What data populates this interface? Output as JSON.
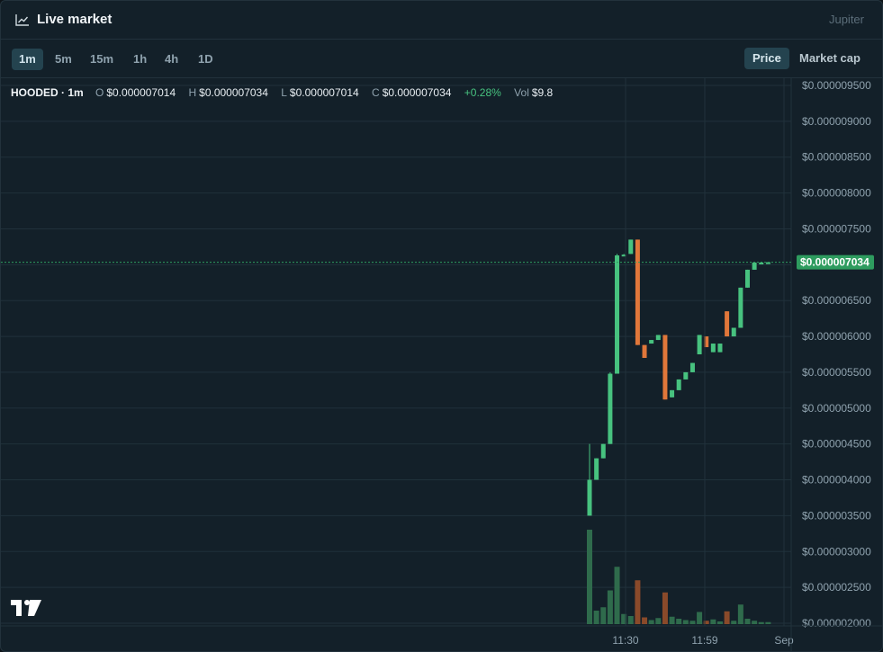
{
  "header": {
    "title": "Live market",
    "provider": "Jupiter",
    "icon": "chart-line-icon"
  },
  "toolbar": {
    "timeframes": [
      "1m",
      "5m",
      "15m",
      "1h",
      "4h",
      "1D"
    ],
    "active_timeframe": "1m",
    "price_label": "Price",
    "marketcap_label": "Market cap",
    "active_toggle": "Price"
  },
  "legend": {
    "symbol": "HOODED · 1m",
    "o_label": "O",
    "o_value": "$0.000007014",
    "h_label": "H",
    "h_value": "$0.000007034",
    "l_label": "L",
    "l_value": "$0.000007014",
    "c_label": "C",
    "c_value": "$0.000007034",
    "change": "+0.28%",
    "vol_label": "Vol",
    "vol_value": "$9.8"
  },
  "colors": {
    "up": "#47c27f",
    "down": "#e0773a",
    "vol_up": "#2f6b4c",
    "vol_down": "#8a4a2a",
    "grid": "#20313b",
    "last_price_bg": "#2e9c5f"
  },
  "chart_data": {
    "type": "candlestick",
    "x_ticks": [
      "11:30",
      "11:59",
      "Sep"
    ],
    "y_ticks": [
      "$0.000009500",
      "$0.000009000",
      "$0.000008500",
      "$0.000008000",
      "$0.000007500",
      "$0.000007000",
      "$0.000006500",
      "$0.000006000",
      "$0.000005500",
      "$0.000005000",
      "$0.000004500",
      "$0.000004000",
      "$0.000003500",
      "$0.000003000",
      "$0.000002500",
      "$0.000002000"
    ],
    "ylim": [
      2e-06,
      9.5e-06
    ],
    "last_price": 7.034e-06,
    "last_price_label": "$0.000007034",
    "candles": [
      {
        "o": 3.5e-06,
        "h": 4.5e-06,
        "l": 3.5e-06,
        "c": 4e-06,
        "v": 14,
        "dir": "up"
      },
      {
        "o": 4e-06,
        "h": 4.3e-06,
        "l": 4e-06,
        "c": 4.3e-06,
        "v": 2,
        "dir": "up"
      },
      {
        "o": 4.3e-06,
        "h": 4.5e-06,
        "l": 4.3e-06,
        "c": 4.5e-06,
        "v": 2.5,
        "dir": "up"
      },
      {
        "o": 4.5e-06,
        "h": 5.5e-06,
        "l": 4.5e-06,
        "c": 5.48e-06,
        "v": 5,
        "dir": "up"
      },
      {
        "o": 5.48e-06,
        "h": 7.15e-06,
        "l": 5.48e-06,
        "c": 7.13e-06,
        "v": 8.5,
        "dir": "up"
      },
      {
        "o": 7.13e-06,
        "h": 7.15e-06,
        "l": 7.13e-06,
        "c": 7.14e-06,
        "v": 1.5,
        "dir": "up"
      },
      {
        "o": 7.15e-06,
        "h": 7.35e-06,
        "l": 7.15e-06,
        "c": 7.35e-06,
        "v": 1.2,
        "dir": "up"
      },
      {
        "o": 7.35e-06,
        "h": 7.35e-06,
        "l": 5.88e-06,
        "c": 5.88e-06,
        "v": 6.5,
        "dir": "down"
      },
      {
        "o": 5.88e-06,
        "h": 5.88e-06,
        "l": 5.7e-06,
        "c": 5.7e-06,
        "v": 1,
        "dir": "down"
      },
      {
        "o": 5.9e-06,
        "h": 5.95e-06,
        "l": 5.9e-06,
        "c": 5.95e-06,
        "v": 0.6,
        "dir": "up"
      },
      {
        "o": 5.95e-06,
        "h": 6.02e-06,
        "l": 5.95e-06,
        "c": 6.02e-06,
        "v": 0.9,
        "dir": "up"
      },
      {
        "o": 6.02e-06,
        "h": 6.02e-06,
        "l": 5.12e-06,
        "c": 5.12e-06,
        "v": 4.7,
        "dir": "down"
      },
      {
        "o": 5.15e-06,
        "h": 5.25e-06,
        "l": 5.15e-06,
        "c": 5.25e-06,
        "v": 1.1,
        "dir": "up"
      },
      {
        "o": 5.25e-06,
        "h": 5.4e-06,
        "l": 5.25e-06,
        "c": 5.4e-06,
        "v": 0.8,
        "dir": "up"
      },
      {
        "o": 5.4e-06,
        "h": 5.5e-06,
        "l": 5.4e-06,
        "c": 5.5e-06,
        "v": 0.6,
        "dir": "up"
      },
      {
        "o": 5.5e-06,
        "h": 5.63e-06,
        "l": 5.5e-06,
        "c": 5.63e-06,
        "v": 0.5,
        "dir": "up"
      },
      {
        "o": 5.75e-06,
        "h": 6.02e-06,
        "l": 5.75e-06,
        "c": 6.02e-06,
        "v": 1.8,
        "dir": "up"
      },
      {
        "o": 6e-06,
        "h": 5.9e-06,
        "l": 5.85e-06,
        "c": 5.85e-06,
        "v": 0.5,
        "dir": "down"
      },
      {
        "o": 5.78e-06,
        "h": 5.9e-06,
        "l": 5.78e-06,
        "c": 5.9e-06,
        "v": 0.7,
        "dir": "up"
      },
      {
        "o": 5.9e-06,
        "h": 5.9e-06,
        "l": 5.78e-06,
        "c": 5.78e-06,
        "v": 0.4,
        "dir": "up"
      },
      {
        "o": 6.35e-06,
        "h": 6.35e-06,
        "l": 6e-06,
        "c": 6e-06,
        "v": 1.9,
        "dir": "down"
      },
      {
        "o": 6e-06,
        "h": 6.12e-06,
        "l": 6e-06,
        "c": 6.12e-06,
        "v": 0.5,
        "dir": "up"
      },
      {
        "o": 6.12e-06,
        "h": 6.68e-06,
        "l": 6.12e-06,
        "c": 6.68e-06,
        "v": 2.9,
        "dir": "up"
      },
      {
        "o": 6.68e-06,
        "h": 6.93e-06,
        "l": 6.68e-06,
        "c": 6.93e-06,
        "v": 0.8,
        "dir": "up"
      },
      {
        "o": 6.93e-06,
        "h": 7.03e-06,
        "l": 6.93e-06,
        "c": 7.03e-06,
        "v": 0.5,
        "dir": "up"
      },
      {
        "o": 7.03e-06,
        "h": 7.04e-06,
        "l": 7.02e-06,
        "c": 7.03e-06,
        "v": 0.3,
        "dir": "up"
      },
      {
        "o": 7.014e-06,
        "h": 7.034e-06,
        "l": 7.014e-06,
        "c": 7.034e-06,
        "v": 0.3,
        "dir": "up"
      }
    ]
  }
}
